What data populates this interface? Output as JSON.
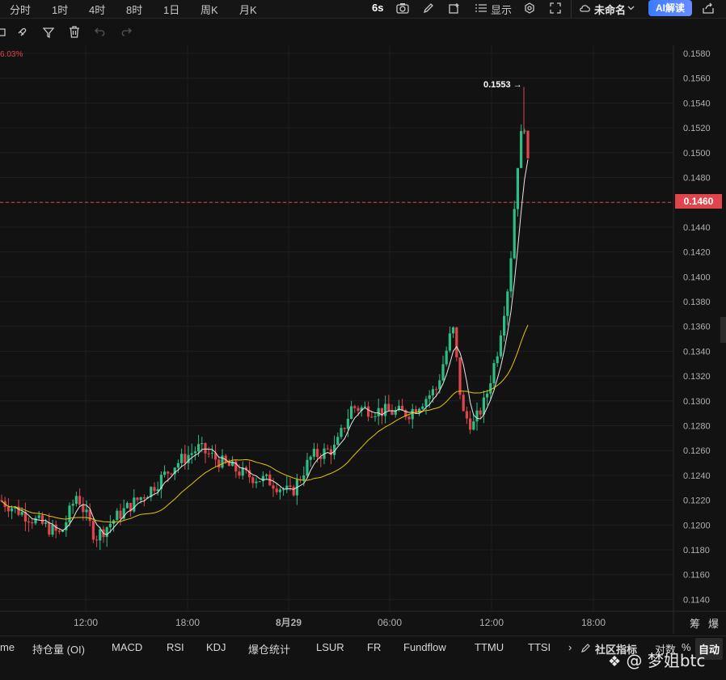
{
  "timeframes": [
    "分时",
    "1时",
    "4时",
    "8时",
    "1日",
    "周K",
    "月K"
  ],
  "toolbar": {
    "interval": "6s",
    "display_label": "显示",
    "layout_name": "未命名",
    "ai_label": "AI解读"
  },
  "chart": {
    "pct_change": "6.03%",
    "high_label": "0.1553",
    "current_price": "0.1460",
    "colors": {
      "up": "#2ebd85",
      "down": "#e0454b",
      "ma_fast": "#e6e6e6",
      "ma_slow": "#e8c600",
      "bg": "#121212",
      "grid": "#1f1f1f"
    },
    "price_axis": [
      "0.1580",
      "0.1560",
      "0.1540",
      "0.1520",
      "0.1500",
      "0.1480",
      "0.1460",
      "0.1440",
      "0.1420",
      "0.1400",
      "0.1380",
      "0.1360",
      "0.1340",
      "0.1320",
      "0.1300",
      "0.1280",
      "0.1260",
      "0.1240",
      "0.1220",
      "0.1200",
      "0.1180",
      "0.1160",
      "0.1140"
    ],
    "time_axis": [
      "12:00",
      "18:00",
      "8月29",
      "06:00",
      "12:00",
      "18:00"
    ],
    "axis_corner": [
      "筹",
      "爆"
    ]
  },
  "indicators": [
    "me",
    "持仓量 (OI)",
    "MACD",
    "RSI",
    "KDJ",
    "爆仓统计",
    "LSUR",
    "FR",
    "Fundflow",
    "TTMU",
    "TTSI",
    "社区指标",
    "对数",
    "%",
    "自动"
  ],
  "watermark": "梦姐btc"
}
